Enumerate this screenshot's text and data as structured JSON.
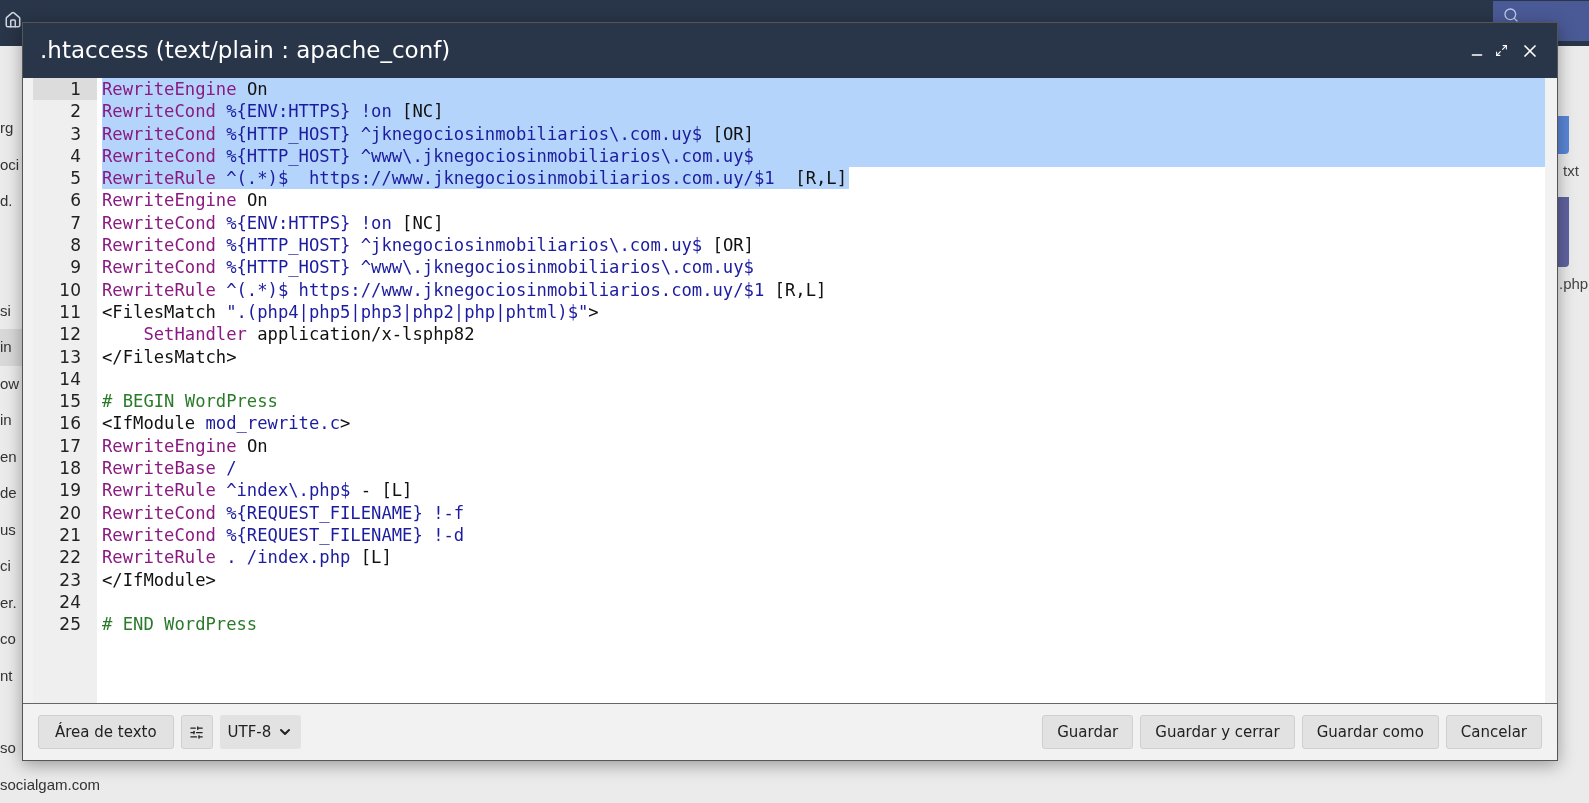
{
  "background_files_left": [
    [
      "rg",
      "oci",
      "d."
    ],
    [
      "si",
      "in",
      "ow",
      "in",
      "en",
      "de",
      "us",
      "ci",
      "er.",
      "co",
      "nt"
    ],
    [
      "so",
      "socialgam.com"
    ]
  ],
  "background_files_right": [
    "txt",
    ".php"
  ],
  "dialog": {
    "title": ".htaccess (text/plain : apache_conf)",
    "editor": {
      "lines": [
        {
          "number": "1",
          "selected": true,
          "current": true,
          "tokens": [
            {
              "kind": "directive",
              "text": "RewriteEngine"
            },
            {
              "kind": "plain",
              "text": " On"
            }
          ]
        },
        {
          "number": "2",
          "selected": true,
          "current": false,
          "tokens": [
            {
              "kind": "directive",
              "text": "RewriteCond"
            },
            {
              "kind": "variable",
              "text": " %{ENV:HTTPS} !on"
            },
            {
              "kind": "plain",
              "text": " [NC]"
            }
          ]
        },
        {
          "number": "3",
          "selected": true,
          "current": false,
          "tokens": [
            {
              "kind": "directive",
              "text": "RewriteCond"
            },
            {
              "kind": "variable",
              "text": " %{HTTP_HOST} ^jknegociosinmobiliarios\\.com.uy$"
            },
            {
              "kind": "plain",
              "text": " [OR]"
            }
          ]
        },
        {
          "number": "4",
          "selected": true,
          "current": false,
          "tokens": [
            {
              "kind": "directive",
              "text": "RewriteCond"
            },
            {
              "kind": "variable",
              "text": " %{HTTP_HOST} ^www\\.jknegociosinmobiliarios\\.com.uy$"
            }
          ]
        },
        {
          "number": "5",
          "selected": true,
          "current": false,
          "tokens": [
            {
              "kind": "directive",
              "text": "RewriteRule"
            },
            {
              "kind": "variable",
              "text": " ^(.*)$  https://www.jknegociosinmobiliarios.com.uy/$1"
            },
            {
              "kind": "plain",
              "text": "  [R,L]"
            }
          ]
        },
        {
          "number": "6",
          "selected": false,
          "current": false,
          "tokens": [
            {
              "kind": "directive",
              "text": "RewriteEngine"
            },
            {
              "kind": "plain",
              "text": " On"
            }
          ]
        },
        {
          "number": "7",
          "selected": false,
          "current": false,
          "tokens": [
            {
              "kind": "directive",
              "text": "RewriteCond"
            },
            {
              "kind": "variable",
              "text": " %{ENV:HTTPS} !on"
            },
            {
              "kind": "plain",
              "text": " [NC]"
            }
          ]
        },
        {
          "number": "8",
          "selected": false,
          "current": false,
          "tokens": [
            {
              "kind": "directive",
              "text": "RewriteCond"
            },
            {
              "kind": "variable",
              "text": " %{HTTP_HOST} ^jknegociosinmobiliarios\\.com.uy$"
            },
            {
              "kind": "plain",
              "text": " [OR]"
            }
          ]
        },
        {
          "number": "9",
          "selected": false,
          "current": false,
          "tokens": [
            {
              "kind": "directive",
              "text": "RewriteCond"
            },
            {
              "kind": "variable",
              "text": " %{HTTP_HOST} ^www\\.jknegociosinmobiliarios\\.com.uy$"
            }
          ]
        },
        {
          "number": "10",
          "selected": false,
          "current": false,
          "tokens": [
            {
              "kind": "directive",
              "text": "RewriteRule"
            },
            {
              "kind": "variable",
              "text": " ^(.*)$ https://www.jknegociosinmobiliarios.com.uy/$1"
            },
            {
              "kind": "plain",
              "text": " [R,L]"
            }
          ]
        },
        {
          "number": "11",
          "selected": false,
          "current": false,
          "tokens": [
            {
              "kind": "plain",
              "text": "<FilesMatch"
            },
            {
              "kind": "variable",
              "text": " \".(php4|php5|php3|php2|php|phtml)$\""
            },
            {
              "kind": "plain",
              "text": ">"
            }
          ]
        },
        {
          "number": "12",
          "selected": false,
          "current": false,
          "tokens": [
            {
              "kind": "directive",
              "text": "    SetHandler"
            },
            {
              "kind": "plain",
              "text": " application/x-lsphp82"
            }
          ]
        },
        {
          "number": "13",
          "selected": false,
          "current": false,
          "tokens": [
            {
              "kind": "plain",
              "text": "</FilesMatch>"
            }
          ]
        },
        {
          "number": "14",
          "selected": false,
          "current": false
        },
        {
          "number": "15",
          "selected": false,
          "current": false,
          "tokens": [
            {
              "kind": "comment",
              "text": "# BEGIN WordPress"
            }
          ]
        },
        {
          "number": "16",
          "selected": false,
          "current": false,
          "tokens": [
            {
              "kind": "plain",
              "text": "<IfModule"
            },
            {
              "kind": "variable",
              "text": " mod_rewrite.c"
            },
            {
              "kind": "plain",
              "text": ">"
            }
          ]
        },
        {
          "number": "17",
          "selected": false,
          "current": false,
          "tokens": [
            {
              "kind": "directive",
              "text": "RewriteEngine"
            },
            {
              "kind": "plain",
              "text": " On"
            }
          ]
        },
        {
          "number": "18",
          "selected": false,
          "current": false,
          "tokens": [
            {
              "kind": "directive",
              "text": "RewriteBase"
            },
            {
              "kind": "variable",
              "text": " /"
            }
          ]
        },
        {
          "number": "19",
          "selected": false,
          "current": false,
          "tokens": [
            {
              "kind": "directive",
              "text": "RewriteRule"
            },
            {
              "kind": "variable",
              "text": " ^index\\.php$"
            },
            {
              "kind": "plain",
              "text": " - [L]"
            }
          ]
        },
        {
          "number": "20",
          "selected": false,
          "current": false,
          "tokens": [
            {
              "kind": "directive",
              "text": "RewriteCond"
            },
            {
              "kind": "variable",
              "text": " %{REQUEST_FILENAME} !-f"
            }
          ]
        },
        {
          "number": "21",
          "selected": false,
          "current": false,
          "tokens": [
            {
              "kind": "directive",
              "text": "RewriteCond"
            },
            {
              "kind": "variable",
              "text": " %{REQUEST_FILENAME} !-d"
            }
          ]
        },
        {
          "number": "22",
          "selected": false,
          "current": false,
          "tokens": [
            {
              "kind": "directive",
              "text": "RewriteRule"
            },
            {
              "kind": "variable",
              "text": " . /index.php"
            },
            {
              "kind": "plain",
              "text": " [L]"
            }
          ]
        },
        {
          "number": "23",
          "selected": false,
          "current": false,
          "tokens": [
            {
              "kind": "plain",
              "text": "</IfModule>"
            }
          ]
        },
        {
          "number": "24",
          "selected": false,
          "current": false
        },
        {
          "number": "25",
          "selected": false,
          "current": false,
          "tokens": [
            {
              "kind": "comment",
              "text": "# END WordPress"
            }
          ]
        }
      ]
    },
    "footer": {
      "mode_button": "Área de texto",
      "encoding": "UTF-8",
      "buttons": [
        "Guardar",
        "Guardar y cerrar",
        "Guardar como",
        "Cancelar"
      ]
    }
  }
}
